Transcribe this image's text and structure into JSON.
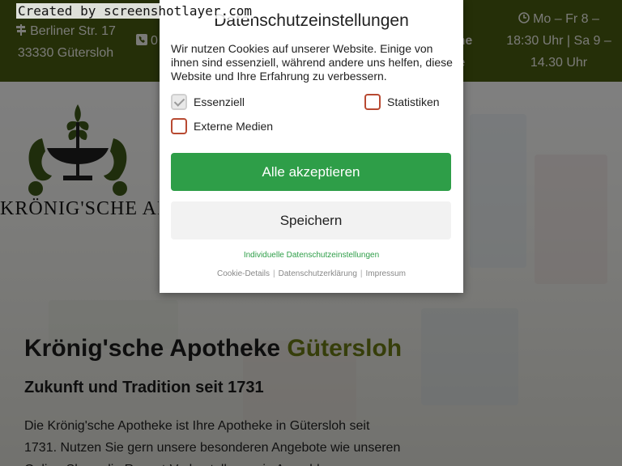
{
  "watermark": "Created by screenshotlayer.com",
  "topbar": {
    "address_line1": "Berliner Str. 17",
    "address_line2": "33330 Gütersloh",
    "phone_partial": "0",
    "mid_line1": "sche",
    "mid_line2": "de",
    "hours_line1": "Mo – Fr 8 –",
    "hours_line2": "18:30 Uhr | Sa 9 –",
    "hours_line3": "14.30 Uhr",
    "background": "#4b5f10"
  },
  "logo": {
    "text": "KRÖNIG'SCHE APOTHEKE"
  },
  "hero": {
    "title": "Krönig'sche Apotheke",
    "title_accent": "Gütersloh",
    "subtitle": "Zukunft und Tradition seit 1731",
    "body": "Die Krönig'sche Apotheke ist Ihre Apotheke in Gütersloh seit 1731. Nutzen Sie gern unsere besonderen Angebote wie unseren Online-Shop, die Rezept-Vorbestellung, ein Anmeldung",
    "accent_color": "#6d7c14"
  },
  "modal": {
    "title": "Datenschutzeinstellungen",
    "description": "Wir nutzen Cookies auf unserer Website. Einige von ihnen sind essenziell, während andere uns helfen, diese Website und Ihre Erfahrung zu verbessern.",
    "checkboxes": [
      {
        "label": "Essenziell",
        "checked": true
      },
      {
        "label": "Statistiken",
        "checked": false
      },
      {
        "label": "Externe Medien",
        "checked": false
      }
    ],
    "accept_label": "Alle akzeptieren",
    "save_label": "Speichern",
    "individual_link": "Individuelle Datenschutzeinstellungen",
    "footer": {
      "cookie_details": "Cookie-Details",
      "privacy": "Datenschutzerklärung",
      "imprint": "Impressum"
    },
    "accept_color": "#2e9e48"
  }
}
